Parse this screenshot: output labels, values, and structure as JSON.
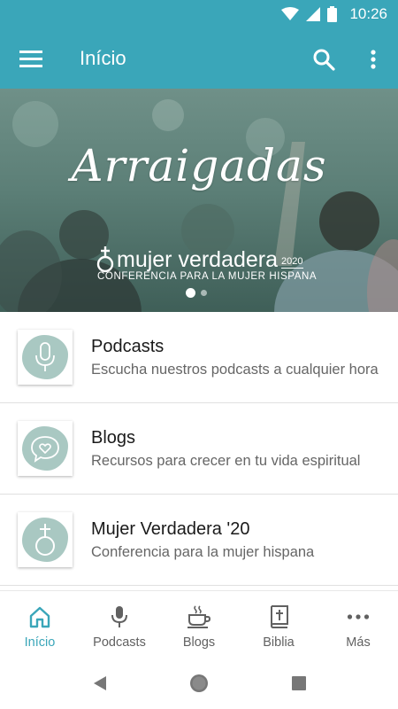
{
  "status_bar": {
    "time": "10:26"
  },
  "app_bar": {
    "title": "Início"
  },
  "banner": {
    "title": "Arraigadas",
    "brand": "mujer verdadera",
    "year": "2020",
    "tagline": "CONFERENCIA PARA LA MUJER HISPANA",
    "current_slide": 1,
    "total_slides": 2
  },
  "list": [
    {
      "title": "Podcasts",
      "subtitle": "Escucha nuestros podcasts a cualquier hora",
      "icon": "microphone-icon"
    },
    {
      "title": "Blogs",
      "subtitle": "Recursos para crecer en tu vida espiritual",
      "icon": "heart-chat-icon"
    },
    {
      "title": "Mujer Verdadera '20",
      "subtitle": "Conferencia para la mujer hispana",
      "icon": "cross-ring-icon"
    }
  ],
  "bottom_nav": [
    {
      "label": "Início",
      "icon": "home-icon",
      "active": true
    },
    {
      "label": "Podcasts",
      "icon": "microphone-icon"
    },
    {
      "label": "Blogs",
      "icon": "cup-icon"
    },
    {
      "label": "Biblia",
      "icon": "bible-icon"
    },
    {
      "label": "Más",
      "icon": "more-horizontal-icon"
    }
  ],
  "colors": {
    "primary": "#3aa6b9",
    "thumb": "#a9c8c2",
    "text": "#1a1a1a",
    "muted": "#666666"
  }
}
